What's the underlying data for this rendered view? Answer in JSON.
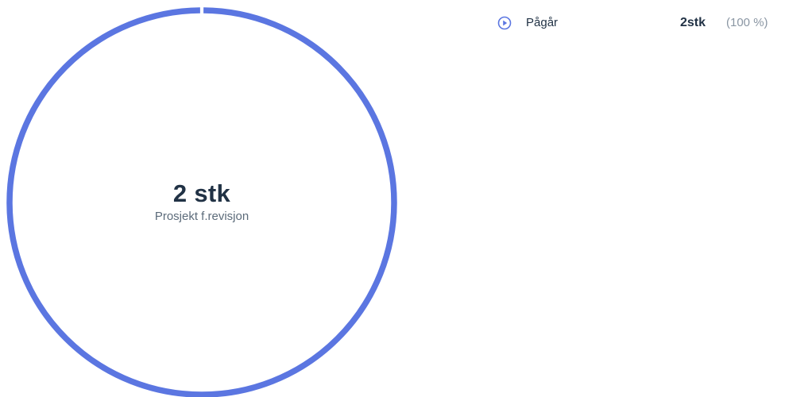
{
  "chart_data": {
    "type": "pie",
    "style": "donut",
    "categories": [
      "Pågår"
    ],
    "values": [
      2
    ],
    "percentages": [
      100
    ],
    "total_label": "2 stk",
    "subtitle": "Prosjekt f.revisjon",
    "colors": [
      "#5b76e1"
    ],
    "legend_placement": "right"
  },
  "legend": {
    "items": [
      {
        "label": "Pågår",
        "value": "2stk",
        "percent": "(100 %)",
        "icon": "play-circle-icon",
        "color": "#5b76e1"
      }
    ]
  }
}
